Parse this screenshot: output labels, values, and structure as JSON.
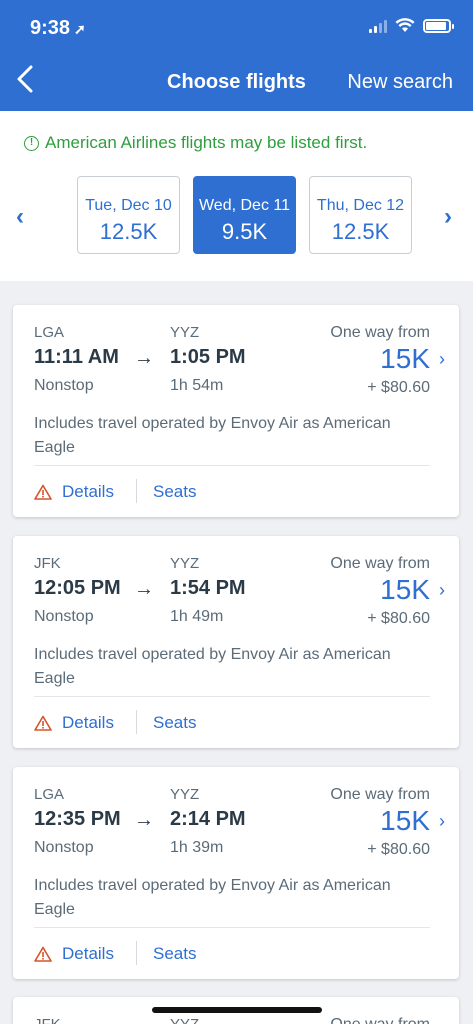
{
  "status": {
    "time": "9:38",
    "location_icon": "location-arrow-icon"
  },
  "header": {
    "title": "Choose flights",
    "new_search": "New search"
  },
  "notice": {
    "text": "American Airlines flights may be listed first."
  },
  "dates": [
    {
      "day": "Tue, Dec 10",
      "price": "12.5K",
      "selected": false
    },
    {
      "day": "Wed, Dec 11",
      "price": "9.5K",
      "selected": true
    },
    {
      "day": "Thu, Dec 12",
      "price": "12.5K",
      "selected": false
    }
  ],
  "flights": [
    {
      "origin": "LGA",
      "destination": "YYZ",
      "one_way": "One way from",
      "depart": "11:11 AM",
      "arrive": "1:05 PM",
      "price": "15K",
      "stops": "Nonstop",
      "duration": "1h 54m",
      "fee": "+ $80.60",
      "note": "Includes travel operated by Envoy Air as American Eagle",
      "details": "Details",
      "seats": "Seats"
    },
    {
      "origin": "JFK",
      "destination": "YYZ",
      "one_way": "One way from",
      "depart": "12:05 PM",
      "arrive": "1:54 PM",
      "price": "15K",
      "stops": "Nonstop",
      "duration": "1h 49m",
      "fee": "+ $80.60",
      "note": "Includes travel operated by Envoy Air as American Eagle",
      "details": "Details",
      "seats": "Seats"
    },
    {
      "origin": "LGA",
      "destination": "YYZ",
      "one_way": "One way from",
      "depart": "12:35 PM",
      "arrive": "2:14 PM",
      "price": "15K",
      "stops": "Nonstop",
      "duration": "1h 39m",
      "fee": "+ $80.60",
      "note": "Includes travel operated by Envoy Air as American Eagle",
      "details": "Details",
      "seats": "Seats"
    }
  ],
  "partial_card": {
    "origin": "JFK",
    "destination": "YYZ",
    "one_way": "One way from"
  },
  "colors": {
    "brand": "#2f6fd1",
    "notice_green": "#2e9e3e",
    "warning": "#d2552b"
  }
}
